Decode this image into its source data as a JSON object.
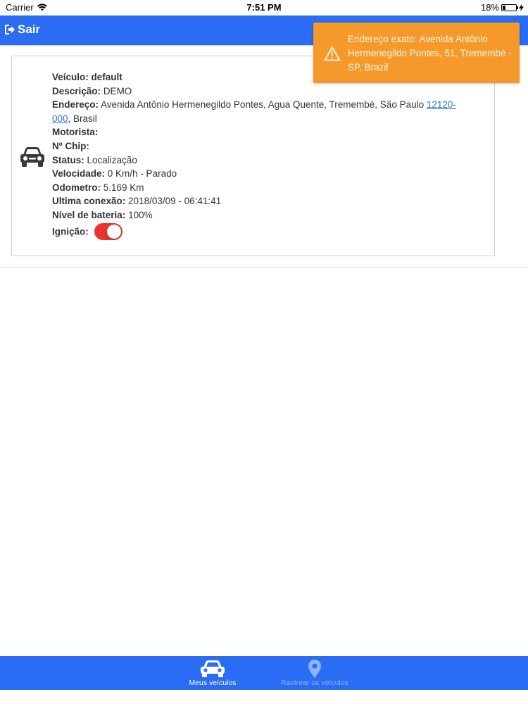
{
  "status_bar": {
    "carrier": "Carrier",
    "time": "7:51 PM",
    "battery": "18%"
  },
  "header": {
    "logout_label": "Sair"
  },
  "toast": {
    "message": "Endereço exato: Avenida Antônio Hermenegildo Pontes, 51, Tremembé - SP, Brazil",
    "color": "#f59a2a",
    "icon": "warning-icon"
  },
  "vehicle": {
    "icon": "car-icon",
    "veiculo_label": "Veículo:",
    "veiculo_value": "default",
    "descricao_label": "Descrição:",
    "descricao_value": "DEMO",
    "endereco_label": "Endereço:",
    "endereco_value": "Avenida Antônio Hermenegildo Pontes, Agua Quente, Tremembé, São Paulo",
    "endereco_cep": "12120-000",
    "endereco_country": ", Brasil",
    "motorista_label": "Motorista:",
    "motorista_value": "",
    "chip_label": "Nº Chip:",
    "chip_value": "",
    "status_label": "Status:",
    "status_value": "Localização",
    "velocidade_label": "Velocidade:",
    "velocidade_value": "0 Km/h - Parado",
    "odometro_label": "Odometro:",
    "odometro_value": "5.169 Km",
    "ultima_label": "Ultima conexão:",
    "ultima_value": "2018/03/09 - 06:41:41",
    "bateria_label": "Nível de bateria:",
    "bateria_value": "100%",
    "ignicao_label": "Ignição:",
    "ignicao_on": true
  },
  "tabs": [
    {
      "label": "Meus veículos",
      "icon": "car-icon",
      "active": true
    },
    {
      "label": "Rastrear os veículos",
      "icon": "map-pin-icon",
      "active": false
    }
  ],
  "colors": {
    "primary": "#2a6df4",
    "toggle_on": "#e8332e",
    "link": "#2a6df4"
  }
}
